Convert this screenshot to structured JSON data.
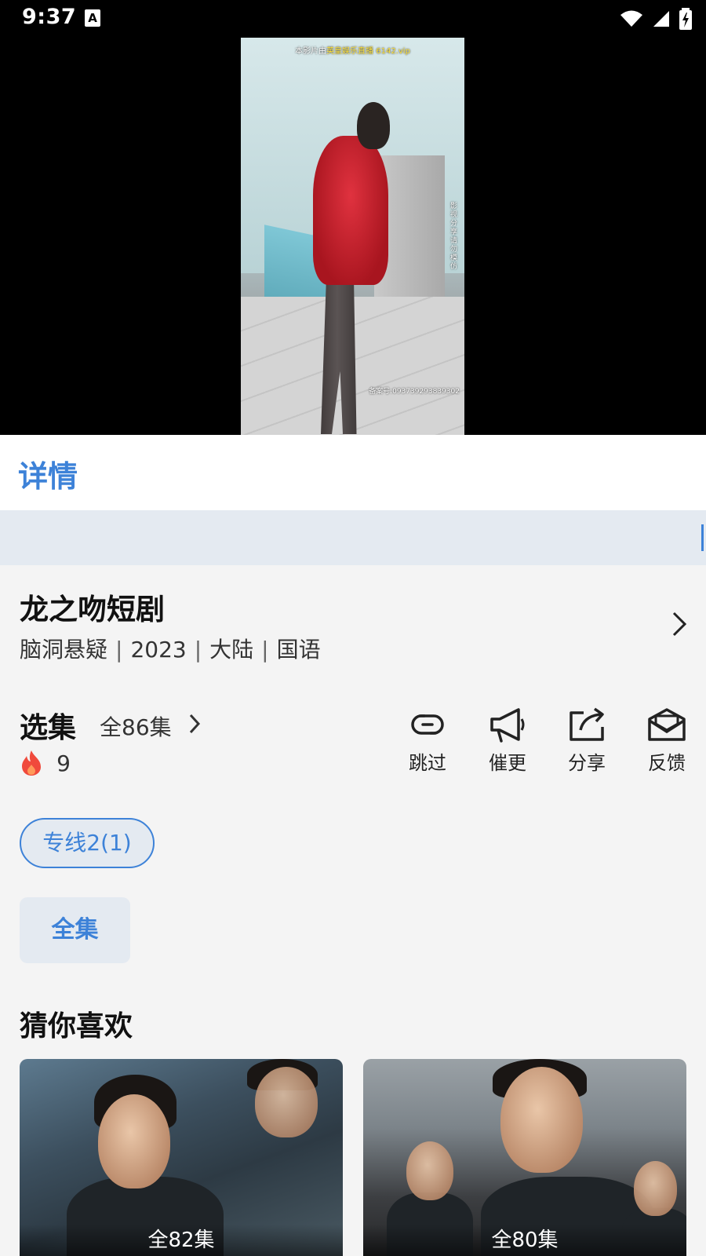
{
  "status_bar": {
    "time": "9:37",
    "notification_icon": "A"
  },
  "video": {
    "watermark_top_prefix": "本影片由",
    "watermark_top_highlight": "英皇娱乐直播 6142.vip",
    "watermark_side": "影视 分享 请勿模仿",
    "watermark_bottom": "备案号:093739293839302"
  },
  "detail_tab": {
    "label": "详情"
  },
  "drama": {
    "title": "龙之吻短剧",
    "genre": "脑洞悬疑",
    "year": "2023",
    "region": "大陆",
    "language": "国语"
  },
  "episodes": {
    "label": "选集",
    "count_label": "全86集",
    "hot_count": "9"
  },
  "actions": [
    {
      "label": "跳过",
      "icon": "link-icon"
    },
    {
      "label": "催更",
      "icon": "megaphone-icon"
    },
    {
      "label": "分享",
      "icon": "share-icon"
    },
    {
      "label": "反馈",
      "icon": "mail-icon"
    }
  ],
  "line_chip": {
    "label": "专线2(1)"
  },
  "all_episodes_button": {
    "label": "全集"
  },
  "recommendations": {
    "heading": "猜你喜欢",
    "items": [
      {
        "episodes": "全82集"
      },
      {
        "episodes": "全80集"
      }
    ]
  },
  "colors": {
    "accent": "#3d82d8",
    "accent_bg": "#e4eaf1",
    "fire": "#f04a3c"
  }
}
